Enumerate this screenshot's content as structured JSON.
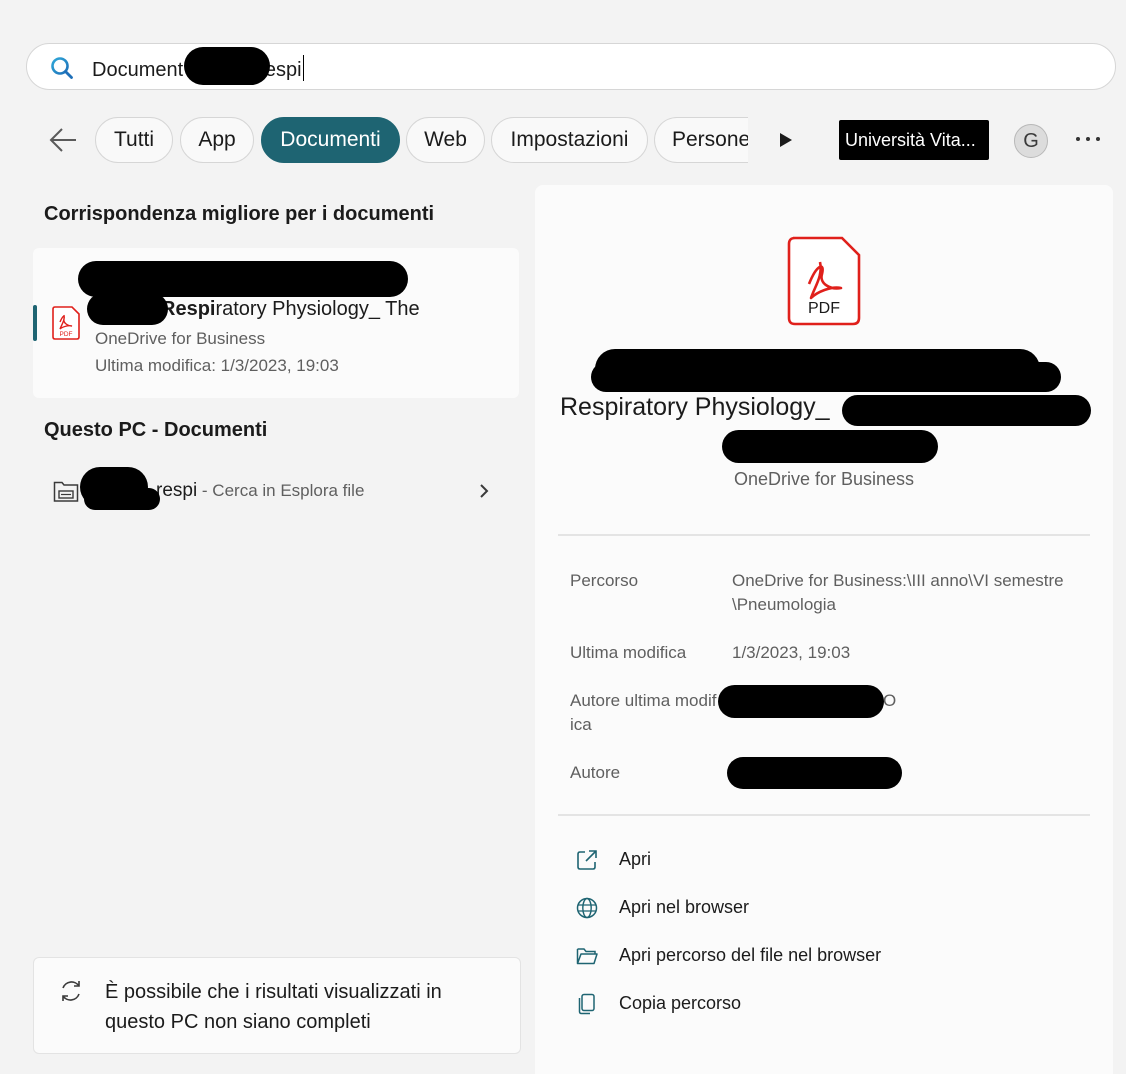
{
  "search": {
    "value_prefix": "Document",
    "value_suffix": "respi"
  },
  "filters": {
    "items": [
      "Tutti",
      "App",
      "Documenti",
      "Web",
      "Impostazioni",
      "Persone"
    ],
    "active": "Documenti",
    "org": "Università Vita...",
    "avatar": "G"
  },
  "left": {
    "best_match_title": "Corrispondenza migliore per i documenti",
    "best_match": {
      "title_bold": "Respi",
      "title_rest": "ratory Physiology_ The",
      "source": "OneDrive for Business",
      "modified": "Ultima modifica: 1/3/2023, 19:03"
    },
    "pc_section_title": "Questo PC - Documenti",
    "pc_row": {
      "query": "respi",
      "hint": " - Cerca in Esplora file"
    },
    "note": "È possibile che i risultati visualizzati in questo PC non siano completi"
  },
  "preview": {
    "title": "Respiratory Physiology_",
    "source": "OneDrive for Business",
    "meta": [
      {
        "label": "Percorso",
        "value": "OneDrive for Business:\\III anno\\VI semestre\\Pneumologia"
      },
      {
        "label": "Ultima modifica",
        "value": "1/3/2023, 19:03"
      },
      {
        "label": "Autore ultima modifica",
        "value": "O"
      },
      {
        "label": "Autore",
        "value": ""
      }
    ],
    "actions": [
      "Apri",
      "Apri nel browser",
      "Apri percorso del file nel browser",
      "Copia percorso"
    ],
    "pdf_label": "PDF"
  },
  "colors": {
    "accent": "#1e6472",
    "pdf_red": "#e0201b"
  },
  "icons": [
    "search-icon",
    "back-arrow-icon",
    "play-icon",
    "pdf-icon",
    "folder-icon",
    "chevron-right-icon",
    "refresh-icon",
    "external-link-icon",
    "globe-icon",
    "folder-open-icon",
    "copy-icon"
  ]
}
